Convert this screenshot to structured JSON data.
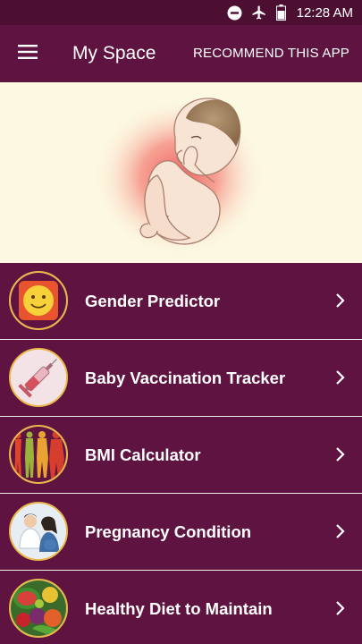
{
  "status_bar": {
    "time": "12:28 AM",
    "icons": [
      "do-not-disturb-icon",
      "airplane-mode-icon",
      "battery-icon"
    ]
  },
  "app_bar": {
    "title": "My Space",
    "menu_icon": "hamburger-menu-icon",
    "recommend_label": "RECOMMEND THIS APP"
  },
  "hero": {
    "image": "fetus-illustration"
  },
  "menu": {
    "items": [
      {
        "label": "Gender Predictor",
        "icon": "smiley-face-icon"
      },
      {
        "label": "Baby Vaccination Tracker",
        "icon": "syringe-icon"
      },
      {
        "label": "BMI Calculator",
        "icon": "body-silhouettes-icon"
      },
      {
        "label": "Pregnancy Condition",
        "icon": "doctor-patient-icon"
      },
      {
        "label": "Healthy Diet to Maintain",
        "icon": "fruits-vegetables-icon"
      }
    ]
  },
  "colors": {
    "app_bar": "#5e1340",
    "status_bar": "#4d0f31",
    "card": "#5e1340",
    "hero_background": "#fcf8e1",
    "icon_ring": "#e8b84a"
  }
}
